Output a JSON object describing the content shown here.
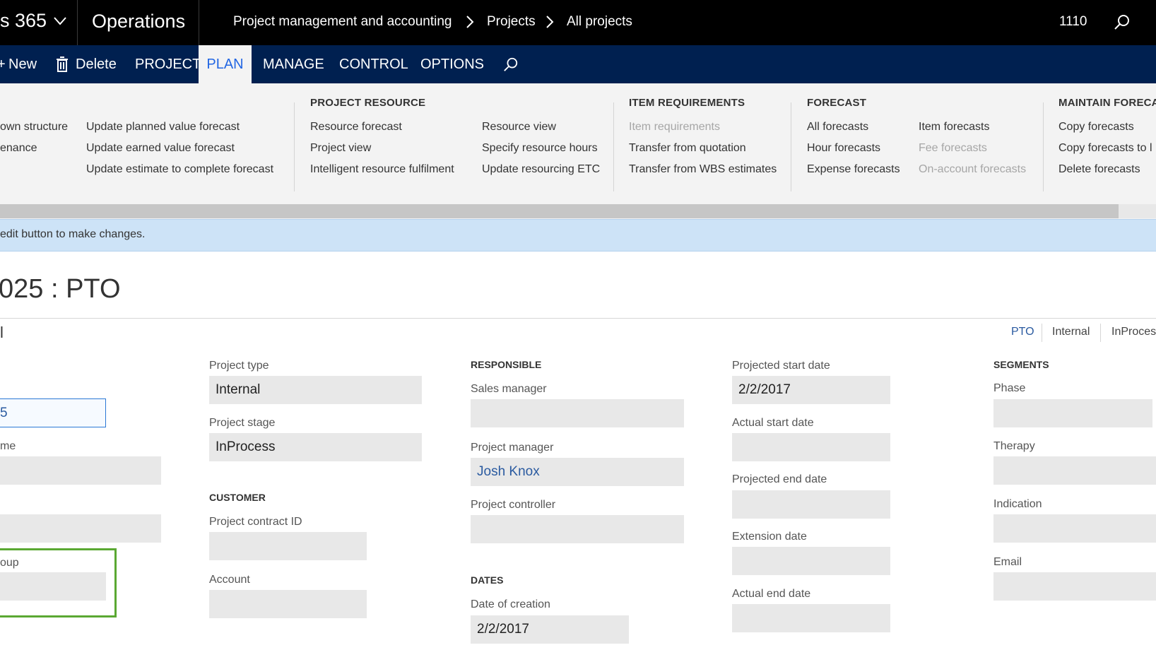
{
  "nav": {
    "app": "s 365",
    "module": "Operations",
    "breadcrumb": [
      "Project management and accounting",
      "Projects",
      "All projects"
    ],
    "company": "1110"
  },
  "actions": {
    "new": "New",
    "delete": "Delete",
    "tabs": [
      "PROJECT",
      "PLAN",
      "MANAGE",
      "CONTROL",
      "OPTIONS"
    ],
    "active_tab": "PLAN"
  },
  "ribbon": {
    "col0": [
      "own structure",
      "enance"
    ],
    "col1": [
      "Update planned value forecast",
      "Update earned value forecast",
      "Update estimate to complete forecast"
    ],
    "project_resource": {
      "header": "PROJECT RESOURCE",
      "left": [
        "Resource forecast",
        "Project view",
        "Intelligent resource fulfilment"
      ],
      "right": [
        "Resource view",
        "Specify resource hours",
        "Update resourcing ETC"
      ]
    },
    "item_requirements": {
      "header": "ITEM REQUIREMENTS",
      "items": [
        "Item requirements",
        "Transfer from quotation",
        "Transfer from WBS estimates"
      ]
    },
    "forecast": {
      "header": "FORECAST",
      "left": [
        "All forecasts",
        "Hour forecasts",
        "Expense forecasts"
      ],
      "right": [
        "Item forecasts",
        "Fee forecasts",
        "On-account forecasts"
      ]
    },
    "maintain": {
      "header": "MAINTAIN FORECA",
      "items": [
        "Copy forecasts",
        "Copy forecasts to l",
        "Delete forecasts"
      ]
    }
  },
  "info": "edit button to make changes.",
  "title": "025 : PTO",
  "section_tab": "l",
  "header_pills": [
    "PTO",
    "Internal",
    "InProces"
  ],
  "form": {
    "col0": {
      "id_value": "5",
      "name_label": "me",
      "group_label": "oup"
    },
    "project_type": {
      "label": "Project type",
      "value": "Internal"
    },
    "project_stage": {
      "label": "Project stage",
      "value": "InProcess"
    },
    "customer": {
      "header": "CUSTOMER",
      "contract_label": "Project contract ID",
      "account_label": "Account"
    },
    "responsible": {
      "header": "RESPONSIBLE",
      "sales_manager": "Sales manager",
      "project_manager": "Project manager",
      "project_manager_value": "Josh Knox",
      "project_controller": "Project controller"
    },
    "dates": {
      "header": "DATES",
      "creation_label": "Date of creation",
      "creation_value": "2/2/2017"
    },
    "schedule": {
      "proj_start": "Projected start date",
      "proj_start_value": "2/2/2017",
      "actual_start": "Actual start date",
      "proj_end": "Projected end date",
      "extension": "Extension date",
      "actual_end": "Actual end date"
    },
    "segments": {
      "header": "SEGMENTS",
      "phase": "Phase",
      "therapy": "Therapy",
      "indication": "Indication",
      "email": "Email"
    }
  }
}
